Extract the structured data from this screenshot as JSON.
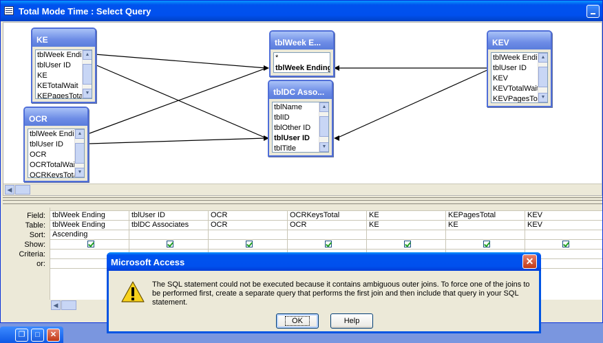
{
  "window": {
    "title": "Total Mode Time : Select Query"
  },
  "tables": {
    "ke": {
      "title": "KE",
      "fields": [
        "tblWeek Ending",
        "tblUser ID",
        "KE",
        "KETotalWait",
        "KEPagesTotal"
      ]
    },
    "ocr": {
      "title": "OCR",
      "fields": [
        "tblWeek Ending",
        "tblUser ID",
        "OCR",
        "OCRTotalWait",
        "OCRKeysTotal"
      ]
    },
    "week": {
      "title": "tblWeek E...",
      "fields": [
        "*",
        "tblWeek Ending"
      ]
    },
    "dc": {
      "title": "tblDC Asso...",
      "fields": [
        "tblName",
        "tblID",
        "tblOther ID",
        "tblUser ID",
        "tblTitle"
      ]
    },
    "kev": {
      "title": "KEV",
      "fields": [
        "tblWeek Ending",
        "tblUser ID",
        "KEV",
        "KEVTotalWait",
        "KEVPagesTotal"
      ]
    }
  },
  "grid": {
    "row_labels": [
      "Field:",
      "Table:",
      "Sort:",
      "Show:",
      "Criteria:",
      "or:"
    ],
    "columns": [
      {
        "field": "tblWeek Ending",
        "table": "tblWeek Ending",
        "sort": "Ascending"
      },
      {
        "field": "tblUser ID",
        "table": "tblDC Associates",
        "sort": ""
      },
      {
        "field": "OCR",
        "table": "OCR",
        "sort": ""
      },
      {
        "field": "OCRKeysTotal",
        "table": "OCR",
        "sort": ""
      },
      {
        "field": "KE",
        "table": "KE",
        "sort": ""
      },
      {
        "field": "KEPagesTotal",
        "table": "KE",
        "sort": ""
      },
      {
        "field": "KEV",
        "table": "KEV",
        "sort": ""
      }
    ]
  },
  "dialog": {
    "title": "Microsoft Access",
    "message": "The SQL statement could not be executed because it contains ambiguous outer joins.  To force one of the joins to be performed first, create a separate query that performs the first join and then include that query in your SQL statement.",
    "ok_label": "OK",
    "help_label": "Help",
    "icon": "warning-icon"
  },
  "minimized": {
    "restore": "restore-icon",
    "maximize": "maximize-icon",
    "close": "close-icon"
  }
}
